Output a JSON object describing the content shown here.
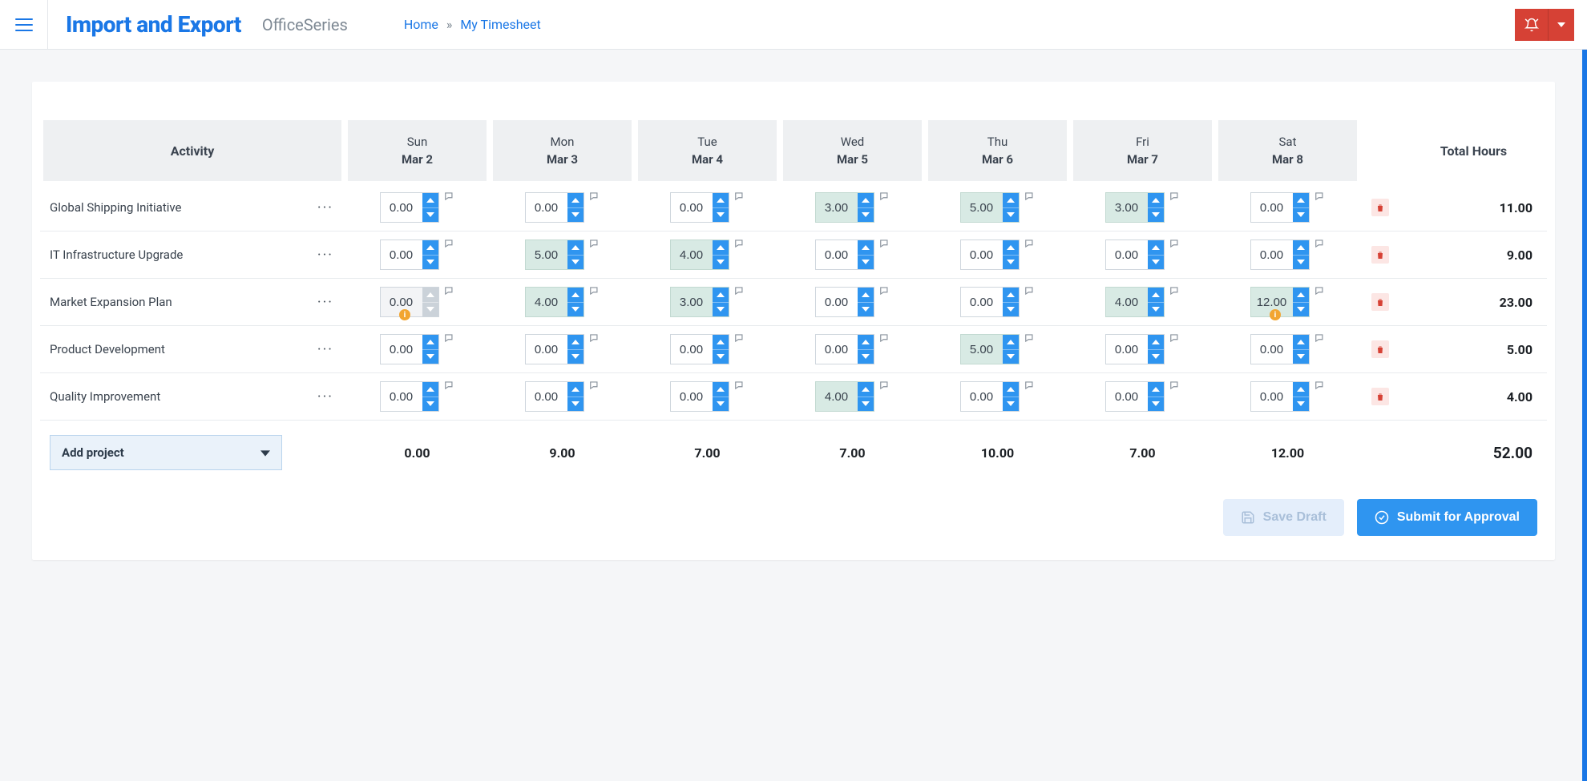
{
  "header": {
    "brand": "Import and Export",
    "sub": "OfficeSeries",
    "breadcrumb_home": "Home",
    "breadcrumb_current": "My Timesheet"
  },
  "table": {
    "activity_label": "Activity",
    "total_label": "Total Hours",
    "days": [
      {
        "name": "Sun",
        "date": "Mar 2"
      },
      {
        "name": "Mon",
        "date": "Mar 3"
      },
      {
        "name": "Tue",
        "date": "Mar 4"
      },
      {
        "name": "Wed",
        "date": "Mar 5"
      },
      {
        "name": "Thu",
        "date": "Mar 6"
      },
      {
        "name": "Fri",
        "date": "Mar 7"
      },
      {
        "name": "Sat",
        "date": "Mar 8"
      }
    ],
    "rows": [
      {
        "activity": "Global Shipping Initiative",
        "hours": [
          {
            "v": "0.00"
          },
          {
            "v": "0.00"
          },
          {
            "v": "0.00"
          },
          {
            "v": "3.00",
            "filled": true
          },
          {
            "v": "5.00",
            "filled": true
          },
          {
            "v": "3.00",
            "filled": true
          },
          {
            "v": "0.00"
          }
        ],
        "total": "11.00"
      },
      {
        "activity": "IT Infrastructure Upgrade",
        "hours": [
          {
            "v": "0.00"
          },
          {
            "v": "5.00",
            "filled": true
          },
          {
            "v": "4.00",
            "filled": true
          },
          {
            "v": "0.00"
          },
          {
            "v": "0.00"
          },
          {
            "v": "0.00"
          },
          {
            "v": "0.00"
          }
        ],
        "total": "9.00"
      },
      {
        "activity": "Market Expansion Plan",
        "hours": [
          {
            "v": "0.00",
            "disabled": true,
            "warn": true
          },
          {
            "v": "4.00",
            "filled": true
          },
          {
            "v": "3.00",
            "filled": true
          },
          {
            "v": "0.00"
          },
          {
            "v": "0.00"
          },
          {
            "v": "4.00",
            "filled": true
          },
          {
            "v": "12.00",
            "filled": true,
            "warn": true
          }
        ],
        "total": "23.00"
      },
      {
        "activity": "Product Development",
        "hours": [
          {
            "v": "0.00"
          },
          {
            "v": "0.00"
          },
          {
            "v": "0.00"
          },
          {
            "v": "0.00"
          },
          {
            "v": "5.00",
            "filled": true
          },
          {
            "v": "0.00"
          },
          {
            "v": "0.00"
          }
        ],
        "total": "5.00"
      },
      {
        "activity": "Quality Improvement",
        "hours": [
          {
            "v": "0.00"
          },
          {
            "v": "0.00"
          },
          {
            "v": "0.00"
          },
          {
            "v": "4.00",
            "filled": true
          },
          {
            "v": "0.00"
          },
          {
            "v": "0.00"
          },
          {
            "v": "0.00"
          }
        ],
        "total": "4.00"
      }
    ],
    "col_totals": [
      "0.00",
      "9.00",
      "7.00",
      "7.00",
      "10.00",
      "7.00",
      "12.00"
    ],
    "grand_total": "52.00",
    "add_project_label": "Add project"
  },
  "actions": {
    "save_draft": "Save Draft",
    "submit": "Submit for Approval"
  }
}
